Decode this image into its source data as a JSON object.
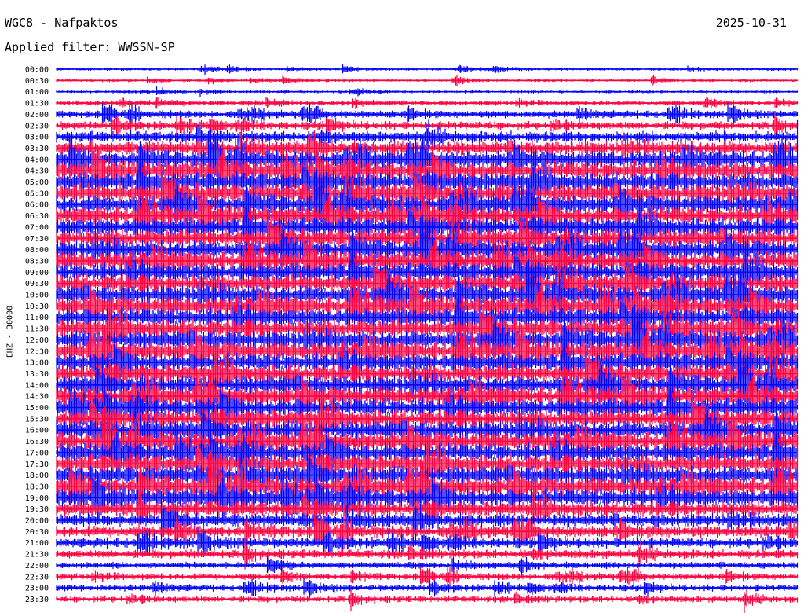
{
  "header": {
    "station": "WGC8 - Nafpaktos",
    "date": "2025-10-31",
    "filter": "Applied filter: WWSSN-SP"
  },
  "channel_label": "EHZ - 30000",
  "chart_data": {
    "type": "line",
    "title": "WGC8 - Nafpaktos",
    "subtitle": "Applied filter: WWSSN-SP",
    "ylabel": "EHZ - 30000",
    "xlabel": "",
    "rows": [
      "00:00",
      "00:30",
      "01:00",
      "01:30",
      "02:00",
      "02:30",
      "03:00",
      "03:30",
      "04:00",
      "04:30",
      "05:00",
      "05:30",
      "06:00",
      "06:30",
      "07:00",
      "07:30",
      "08:00",
      "08:30",
      "09:00",
      "09:30",
      "10:00",
      "10:30",
      "11:00",
      "11:30",
      "12:00",
      "12:30",
      "13:00",
      "13:30",
      "14:00",
      "14:30",
      "15:00",
      "15:30",
      "16:00",
      "16:30",
      "17:00",
      "17:30",
      "18:00",
      "18:30",
      "19:00",
      "19:30",
      "20:00",
      "20:30",
      "21:00",
      "21:30",
      "22:00",
      "22:30",
      "23:00",
      "23:30"
    ],
    "row_colors": [
      "#0000ff",
      "#ff0040"
    ],
    "grid": false,
    "legend": "none"
  }
}
